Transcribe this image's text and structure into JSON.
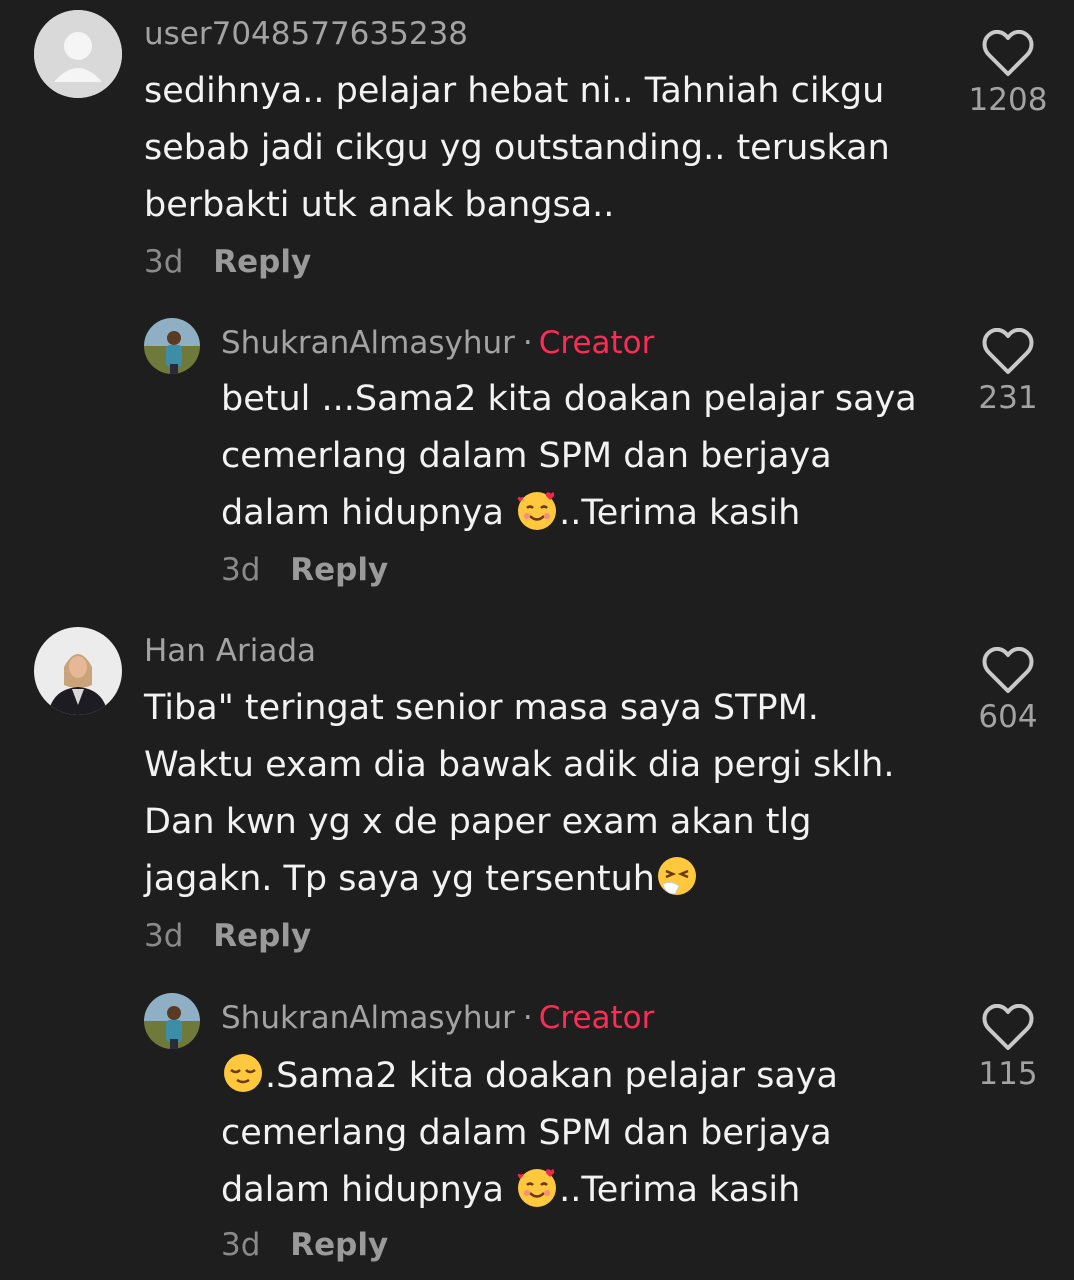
{
  "comments": [
    {
      "username": "user7048577635238",
      "lines": [
        "sedihnya.. pelajar hebat ni.. Tahniah cikgu",
        "sebab jadi cikgu yg outstanding.. teruskan",
        "berbakti utk anak bangsa.."
      ],
      "time": "3d",
      "reply_label": "Reply",
      "likes": "1208",
      "avatar": "default-avatar-icon"
    },
    {
      "username": "ShukranAlmasyhur",
      "separator": "·",
      "badge": "Creator",
      "lines": [
        "betul ...Sama2 kita doakan pelajar saya",
        "cemerlang dalam SPM dan berjaya",
        "..Terima kasih"
      ],
      "line3_prefix": "dalam hidupnya ",
      "time": "3d",
      "reply_label": "Reply",
      "likes": "231",
      "avatar": "user-photo-avatar",
      "emoji": "smiling-face-with-hearts-emoji"
    },
    {
      "username": "Han Ariada",
      "lines": [
        "Tiba\" teringat senior masa saya STPM.",
        "Waktu exam dia bawak adik dia pergi sklh.",
        "Dan kwn yg x de paper exam akan tlg",
        "jagakn. Tp saya yg tersentuh"
      ],
      "time": "3d",
      "reply_label": "Reply",
      "likes": "604",
      "avatar": "user-photo-avatar",
      "emoji": "sneezing-face-emoji"
    },
    {
      "username": "ShukranAlmasyhur",
      "separator": "·",
      "badge": "Creator",
      "lines": [
        ".Sama2 kita doakan pelajar saya",
        "cemerlang dalam SPM dan berjaya",
        "..Terima kasih"
      ],
      "line3_prefix": "dalam hidupnya ",
      "time": "3d",
      "reply_label": "Reply",
      "likes": "115",
      "avatar": "user-photo-avatar",
      "emoji_start": "relieved-face-emoji",
      "emoji": "smiling-face-with-hearts-emoji"
    }
  ],
  "colors": {
    "background": "#1e1e1e",
    "creator_badge": "#fe2c55",
    "text_primary": "#f2f2f2",
    "text_secondary": "#a3a3a3"
  }
}
